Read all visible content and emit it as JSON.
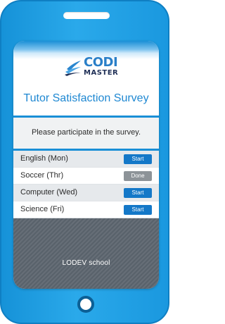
{
  "brand": {
    "logo_line_1": "CODI",
    "logo_line_2": "MASTER"
  },
  "survey": {
    "title": "Tutor Satisfaction Survey",
    "notice": "Please participate in the survey.",
    "items": [
      {
        "label": "English (Mon)",
        "action": "Start",
        "status": "start"
      },
      {
        "label": "Soccer (Thr)",
        "action": "Done",
        "status": "done"
      },
      {
        "label": "Computer (Wed)",
        "action": "Start",
        "status": "start"
      },
      {
        "label": "Science (Fri)",
        "action": "Start",
        "status": "start"
      }
    ]
  },
  "footer": {
    "school": "LODEV school"
  },
  "colors": {
    "phone_blue": "#1a98df",
    "accent_blue": "#1f88d2",
    "start_button": "#1478c8",
    "done_button": "#8d9398",
    "footer_gray": "#59626b"
  },
  "icons": {
    "speaker": "phone-speaker-slot",
    "home": "home-button-circle",
    "logo": "codi-master-logo-mark"
  }
}
